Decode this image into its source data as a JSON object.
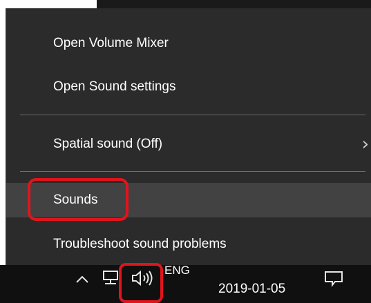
{
  "menu": {
    "items": [
      {
        "label": "Open Volume Mixer"
      },
      {
        "label": "Open Sound settings"
      },
      {
        "label": "Spatial sound (Off)"
      },
      {
        "label": "Sounds"
      },
      {
        "label": "Troubleshoot sound problems"
      }
    ],
    "submenu_chevron": "›"
  },
  "taskbar": {
    "language": "ENG",
    "date": "2019-01-05"
  },
  "icons": {
    "chevron_up": "chevron-up-icon",
    "network": "network-icon",
    "volume": "volume-icon",
    "notifications": "notification-icon"
  },
  "colors": {
    "menu_background": "#2b2b2b",
    "highlight": "#424242",
    "annotation_red": "#e0151c",
    "taskbar_background": "#101010"
  }
}
